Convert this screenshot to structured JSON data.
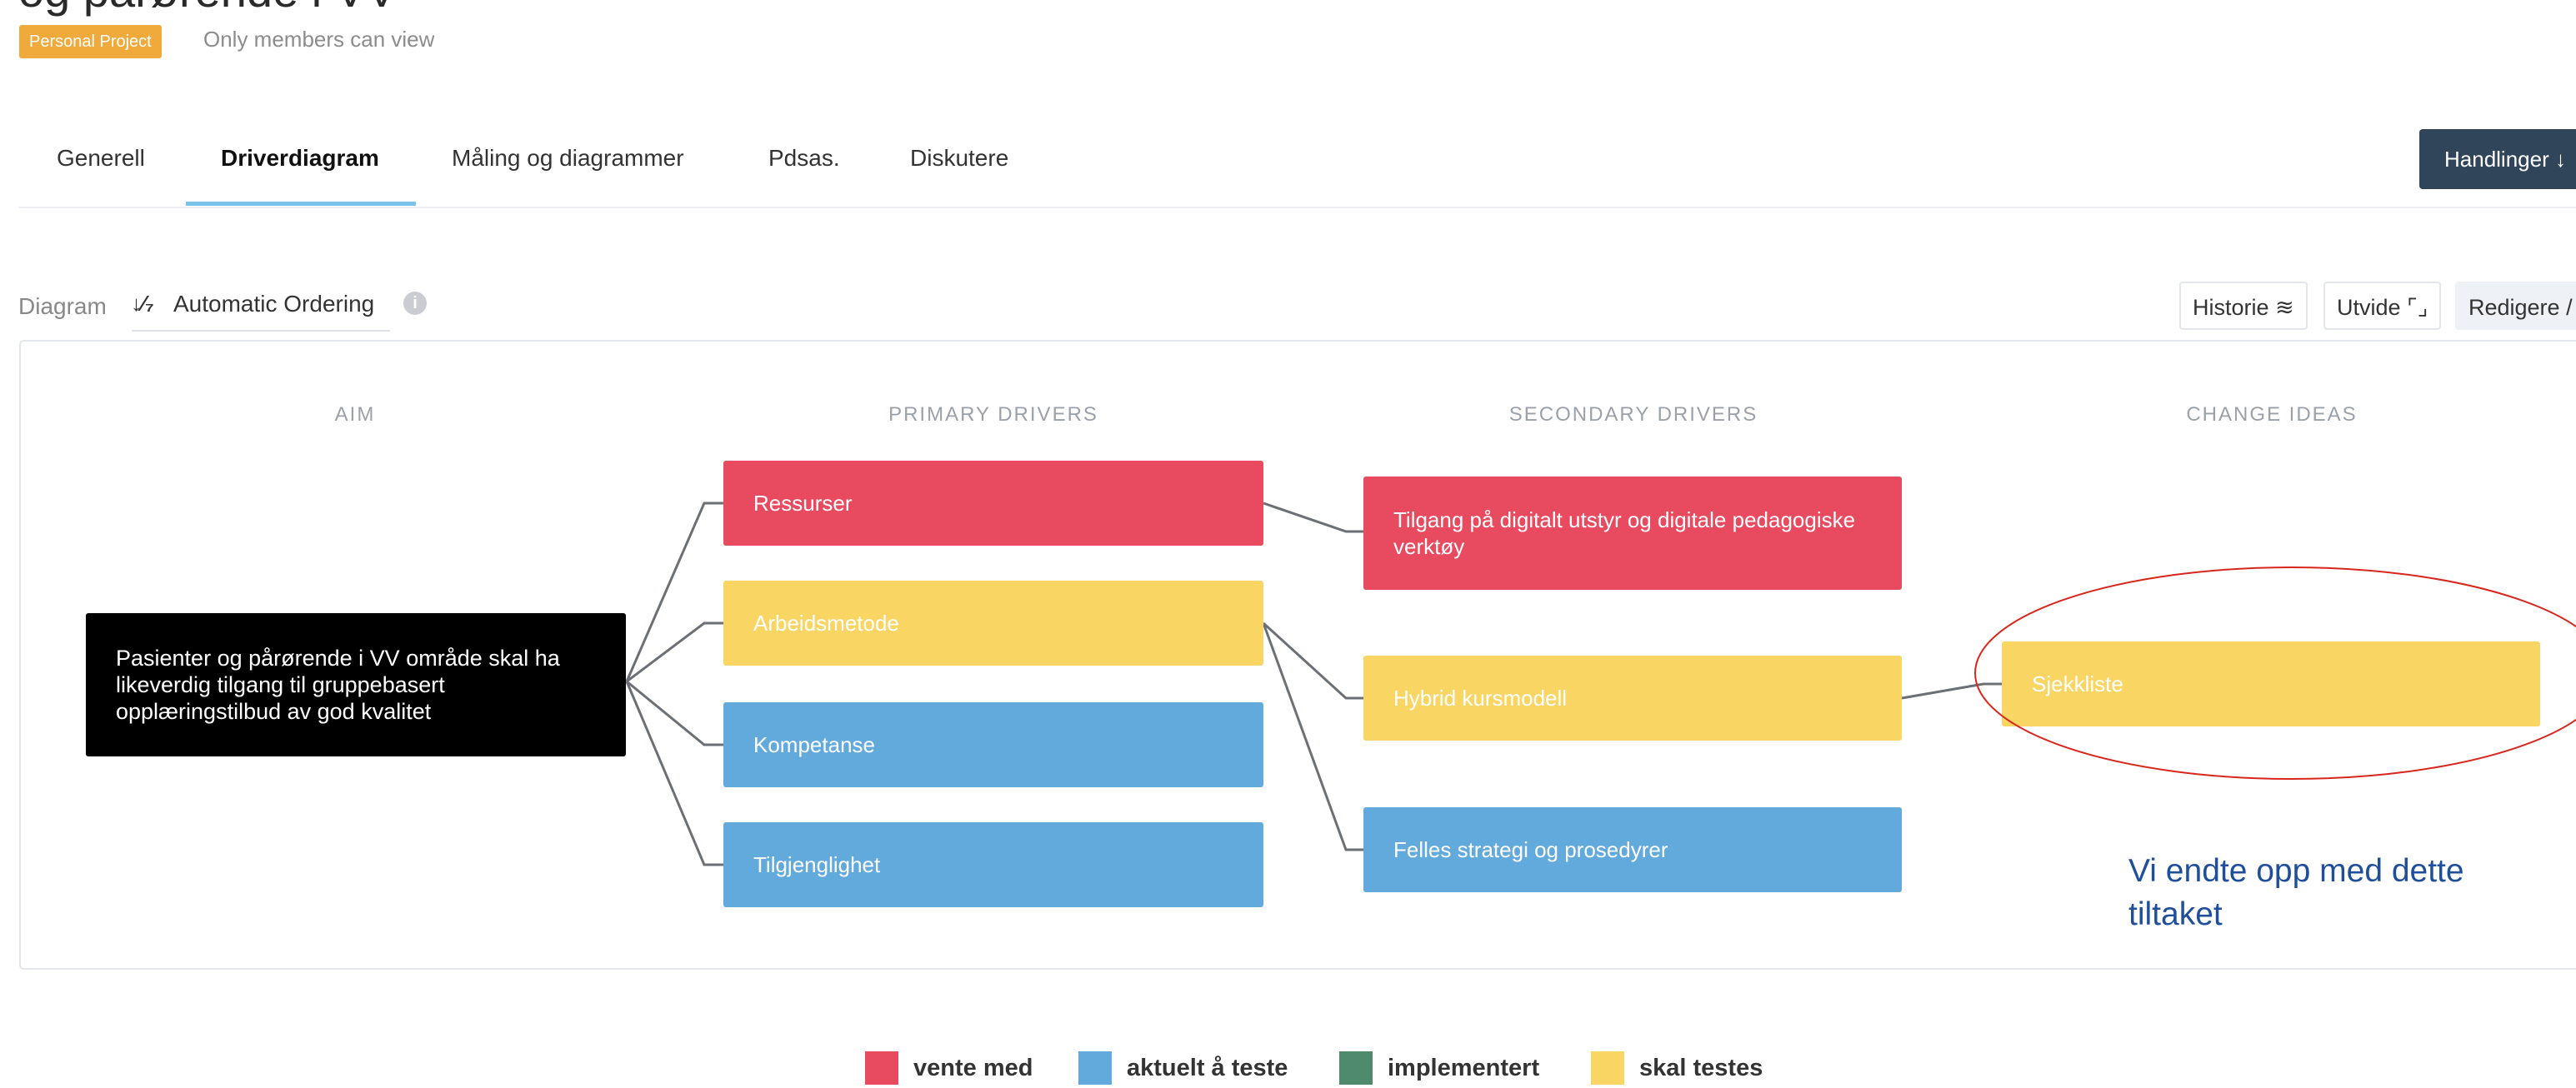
{
  "project": {
    "title_partial": "og pårørende i VV",
    "badge": "Personal Project",
    "visibility": "Only members can view"
  },
  "tabs": [
    {
      "label": "Generell",
      "active": false
    },
    {
      "label": "Driverdiagram",
      "active": true
    },
    {
      "label": "Måling og diagrammer",
      "active": false
    },
    {
      "label": "Pdsas.",
      "active": false
    },
    {
      "label": "Diskutere",
      "active": false
    }
  ],
  "actions_button": "Handlinger ↓",
  "toolbar": {
    "diagram_label": "Diagram",
    "ordering_icon": "↓⁄₇",
    "ordering": "Automatic Ordering",
    "info_icon": "i",
    "history": "Historie ≋",
    "expand": "Utvide ⌜⌟",
    "edit": "Redigere /"
  },
  "columns": {
    "aim": "AIM",
    "primary": "PRIMARY DRIVERS",
    "secondary": "SECONDARY DRIVERS",
    "change": "CHANGE IDEAS"
  },
  "aim": "Pasienter og pårørende i VV område skal ha likeverdig tilgang til gruppebasert opplæringstilbud av god kvalitet",
  "primary": [
    {
      "label": "Ressurser",
      "status": "vente med"
    },
    {
      "label": "Arbeidsmetode",
      "status": "skal testes"
    },
    {
      "label": "Kompetanse",
      "status": "aktuelt å teste"
    },
    {
      "label": "Tilgjenglighet",
      "status": "aktuelt å teste"
    }
  ],
  "secondary": [
    {
      "label": "Tilgang på digitalt utstyr og digitale pedagogiske verktøy",
      "status": "vente med"
    },
    {
      "label": "Hybrid kursmodell",
      "status": "skal testes"
    },
    {
      "label": "Felles strategi og prosedyrer",
      "status": "aktuelt å teste"
    }
  ],
  "change_ideas": [
    {
      "label": "Sjekkliste",
      "status": "skal testes"
    }
  ],
  "annotation": "Vi endte opp med dette tiltaket",
  "legend": [
    {
      "label": "vente med",
      "color": "#e84a5f"
    },
    {
      "label": "aktuelt å teste",
      "color": "#63aadc"
    },
    {
      "label": "implementert",
      "color": "#4f8a6c"
    },
    {
      "label": "skal testes",
      "color": "#f9d563"
    }
  ],
  "colors": {
    "vente_med": "#e84a5f",
    "aktuelt_a_teste": "#63aadc",
    "implementert": "#4f8a6c",
    "skal_testes": "#f9d563",
    "aim": "#000000",
    "annotation_ellipse": "#d9261c",
    "annotation_text": "#1f4e9b"
  }
}
